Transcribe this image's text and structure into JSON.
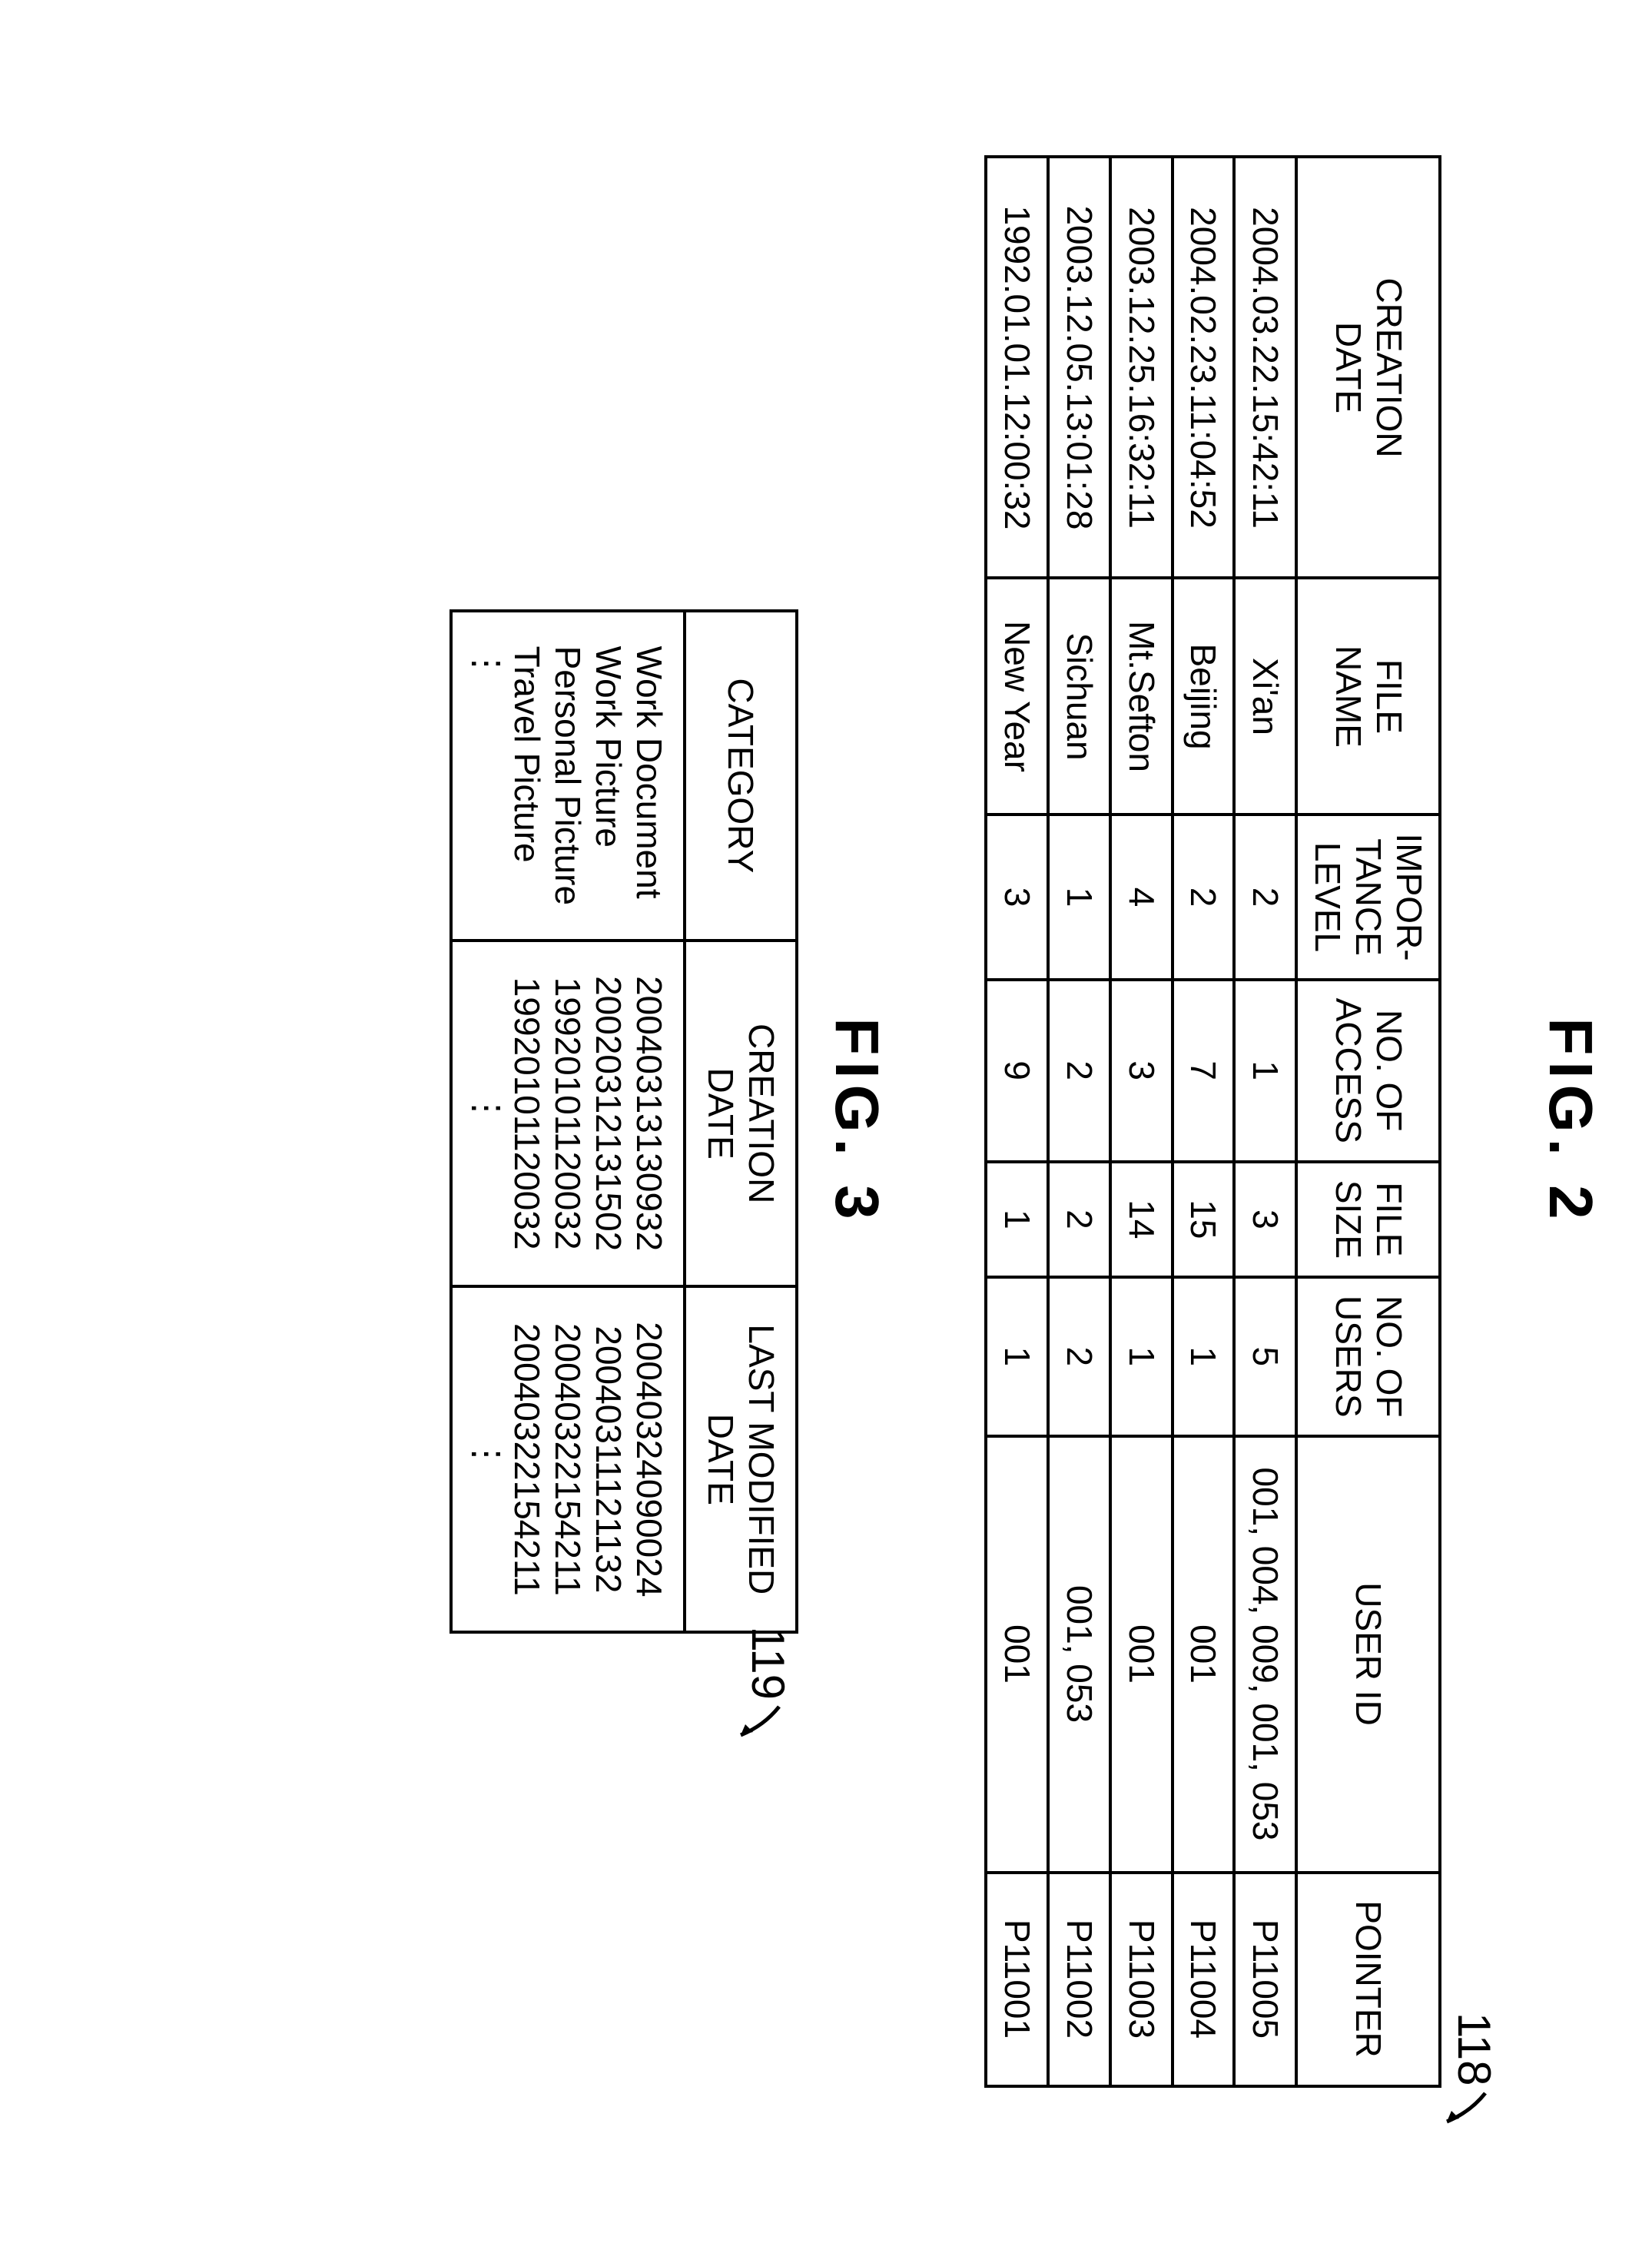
{
  "fig2": {
    "title": "FIG. 2",
    "ref": "118",
    "headers": {
      "creation_date": "CREATION\nDATE",
      "file_name": "FILE\nNAME",
      "importance": "IMPOR-\nTANCE\nLEVEL",
      "access": "NO. OF\nACCESS",
      "file_size": "FILE\nSIZE",
      "users": "NO. OF\nUSERS",
      "user_id": "USER ID",
      "pointer": "POINTER"
    },
    "rows": [
      {
        "creation_date": "2004.03.22.15:42:11",
        "file_name": "Xi'an",
        "importance": "2",
        "access": "1",
        "file_size": "3",
        "users": "5",
        "user_id": "001, 004, 009, 001, 053",
        "pointer": "P11005"
      },
      {
        "creation_date": "2004.02.23.11:04:52",
        "file_name": "Beijing",
        "importance": "2",
        "access": "7",
        "file_size": "15",
        "users": "1",
        "user_id": "001",
        "pointer": "P11004"
      },
      {
        "creation_date": "2003.12.25.16:32:11",
        "file_name": "Mt.Sefton",
        "importance": "4",
        "access": "3",
        "file_size": "14",
        "users": "1",
        "user_id": "001",
        "pointer": "P11003"
      },
      {
        "creation_date": "2003.12.05.13:01:28",
        "file_name": "Sichuan",
        "importance": "1",
        "access": "2",
        "file_size": "2",
        "users": "2",
        "user_id": "001, 053",
        "pointer": "P11002"
      },
      {
        "creation_date": "1992.01.01.12:00:32",
        "file_name": "New Year",
        "importance": "3",
        "access": "9",
        "file_size": "1",
        "users": "1",
        "user_id": "001",
        "pointer": "P11001"
      }
    ]
  },
  "fig3": {
    "title": "FIG. 3",
    "ref": "119",
    "headers": {
      "category": "CATEGORY",
      "creation_date": "CREATION\nDATE",
      "modified_date": "LAST MODIFIED\nDATE"
    },
    "rows": [
      {
        "category": "Work Document",
        "creation_date": "20040313130932",
        "modified_date": "20040324090024"
      },
      {
        "category": "Work Picture",
        "creation_date": "20020312131502",
        "modified_date": "20040311121132"
      },
      {
        "category": "Personal Picture",
        "creation_date": "19920101120032",
        "modified_date": "20040322154211"
      },
      {
        "category": "Travel Picture",
        "creation_date": "19920101120032",
        "modified_date": "20040322154211"
      }
    ],
    "ellipsis": "⋮"
  }
}
